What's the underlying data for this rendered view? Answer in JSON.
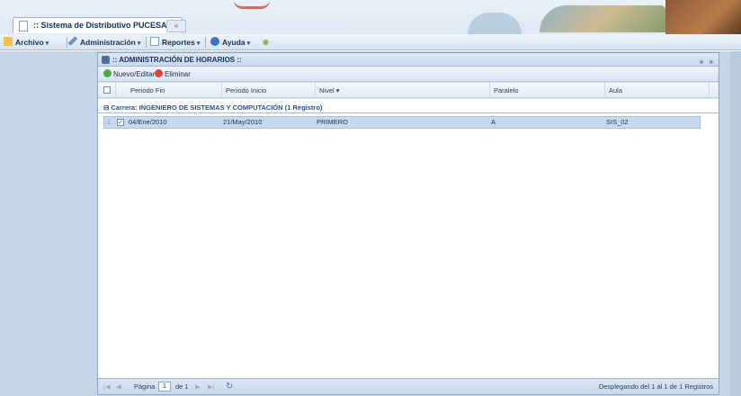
{
  "app": {
    "tab_title": ":: Sistema de Distributivo PUCESA ::"
  },
  "menu": {
    "items": [
      {
        "label": "Archivo",
        "icon": "folder-icon"
      },
      {
        "label": "Administración",
        "icon": "wrench-icon"
      },
      {
        "label": "Reportes",
        "icon": "report-icon"
      },
      {
        "label": "Ayuda",
        "icon": "help-icon"
      }
    ]
  },
  "window": {
    "title": ":: ADMINISTRACIÓN DE HORARIOS ::",
    "tools": "« »"
  },
  "toolbar": {
    "new_edit": "Nuevo/Editar",
    "delete": "Eliminar"
  },
  "grid": {
    "columns": [
      "Periodo Fin",
      "Periodo Inicio",
      "Nivel",
      "Paralelo",
      "Aula"
    ],
    "group_label": "Carrera: INGENIERO DE SISTEMAS Y COMPUTACIÓN (1 Registro)",
    "rows": [
      {
        "periodo_fin": "04/Ene/2010",
        "periodo_inicio": "21/May/2010",
        "nivel": "PRIMERO",
        "paralelo": "A",
        "aula": "SIS_02",
        "checked": true
      }
    ]
  },
  "pager": {
    "page_label": "Página",
    "page_value": "1",
    "of_label": "de 1",
    "status": "Desplegando del 1 al 1 de 1 Registros"
  },
  "colors": {
    "desktop": "#c5d5e8",
    "selected_row": "#c7d9f0",
    "header_text": "#15305e"
  }
}
